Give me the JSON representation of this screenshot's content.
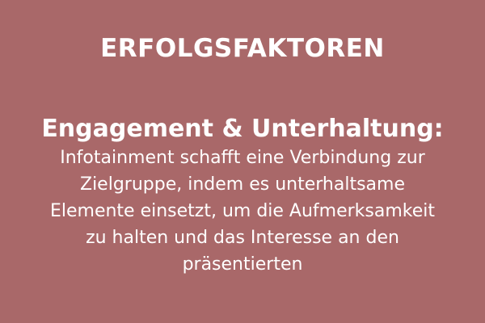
{
  "slide": {
    "title": "ERFOLGSFAKTOREN",
    "heading": "Engagement & Unterhaltung:",
    "body_lines": [
      "Infotainment schafft eine Verbindung zur",
      "Zielgruppe, indem es unterhaltsame",
      "Elemente einsetzt, um die Aufmerksamkeit",
      "zu halten und das Interesse an den",
      "präsentierten"
    ],
    "background_color": "#a96869",
    "text_color": "#ffffff"
  }
}
